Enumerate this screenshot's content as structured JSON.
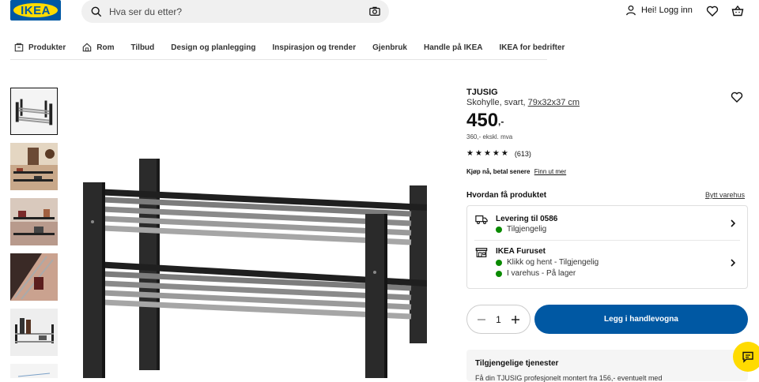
{
  "header": {
    "logo_text": "IKEA",
    "search_placeholder": "Hva ser du etter?",
    "login_label": "Hei! Logg inn"
  },
  "nav": {
    "items": [
      "Produkter",
      "Rom",
      "Tilbud",
      "Design og planlegging",
      "Inspirasjon og trender",
      "Gjenbruk",
      "Handle på IKEA",
      "IKEA for bedrifter"
    ]
  },
  "product": {
    "name": "TJUSIG",
    "description": "Skohylle, svart,",
    "dimensions": "79x32x37 cm",
    "price": "450",
    "price_suffix": ",-",
    "price_ex_vat": "360,- ekskl. mva",
    "rating_stars": 5,
    "reviews": "(613)",
    "klarna_label": "Kjøp nå, betal senere",
    "klarna_link": "Finn ut mer"
  },
  "availability": {
    "title": "Hvordan få produktet",
    "change_store": "Bytt varehus",
    "delivery_title": "Levering til 0586",
    "delivery_status": "Tilgjengelig",
    "store_title": "IKEA Furuset",
    "store_status_1": "Klikk og hent - Tilgjengelig",
    "store_status_2": "I varehus - På lager"
  },
  "cart": {
    "quantity": "1",
    "add_label": "Legg i handlevogna"
  },
  "services": {
    "title": "Tilgjengelige tjenester",
    "text": "Få din TJUSIG profesjonelt montert fra 156,- eventuelt med"
  },
  "colors": {
    "brand_blue": "#0058a3",
    "brand_yellow": "#ffdb00",
    "available_green": "#0a8a00"
  }
}
